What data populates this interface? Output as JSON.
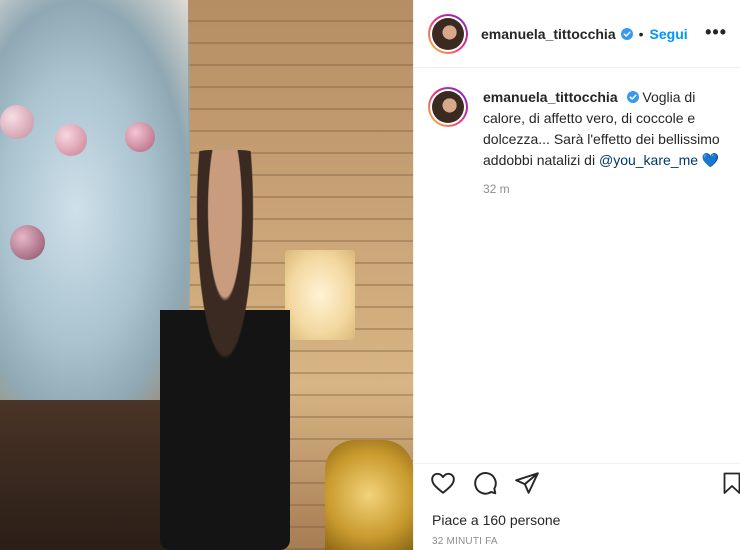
{
  "post": {
    "image_alt": "",
    "username": "emanuela_tittocchia",
    "follow_label": "Segui",
    "more_label": "•••",
    "caption_parts": {
      "text1": "Voglia di calore, di affetto vero, di coccole e dolcezza... Sarà l'effetto dei bellissimo addobbi natalizi di ",
      "mention": "@you_kare_me",
      "emoji": "💙"
    },
    "caption_time": "32 m",
    "likes": "Piace a 160 persone",
    "posted_ago": "32 MINUTI FA"
  },
  "colors": {
    "accent": "#0095f6",
    "verified": "#3897f0",
    "mention": "#00376b"
  },
  "icons": {
    "like": "heart-icon",
    "comment": "comment-icon",
    "share": "send-icon",
    "save": "bookmark-icon",
    "verified": "verified-badge-icon"
  }
}
